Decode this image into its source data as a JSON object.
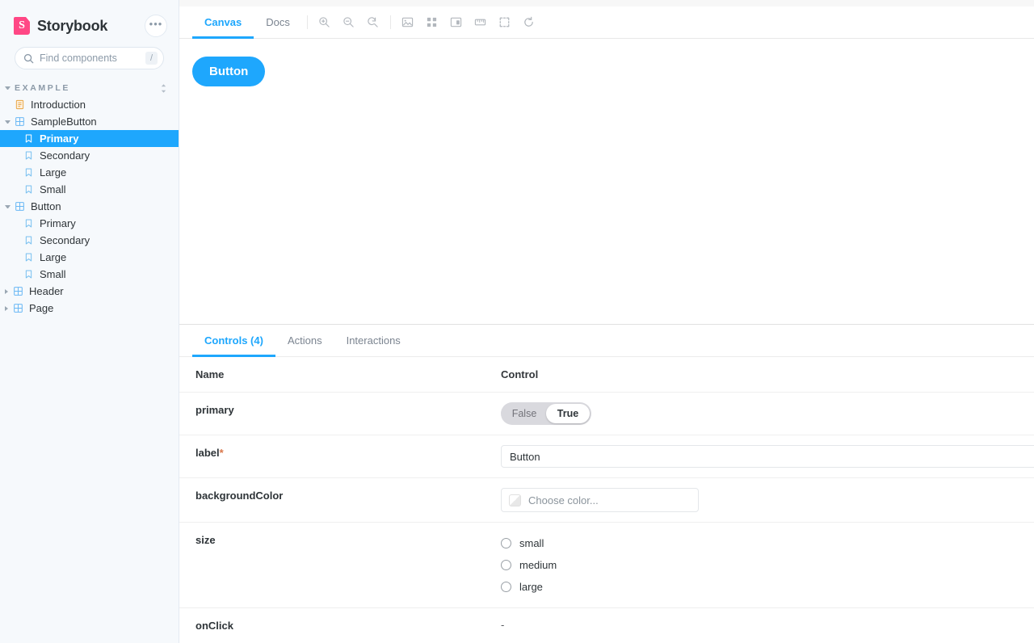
{
  "sidebar": {
    "brand": "Storybook",
    "logo_color": "#ff4785",
    "menu_label": "•••",
    "search": {
      "placeholder": "Find components",
      "value": "",
      "shortcut": "/",
      "icon": "search-icon"
    },
    "group": {
      "label": "EXAMPLE",
      "expanded": true
    },
    "items": [
      {
        "label": "Introduction",
        "icon": "document-icon",
        "level": 2,
        "selected": false,
        "expandable": false
      },
      {
        "label": "SampleButton",
        "icon": "component-icon",
        "level": 2,
        "selected": false,
        "expandable": true,
        "expanded": true
      },
      {
        "label": "Primary",
        "icon": "story-icon",
        "level": 3,
        "selected": true,
        "expandable": false
      },
      {
        "label": "Secondary",
        "icon": "story-icon",
        "level": 3,
        "selected": false,
        "expandable": false
      },
      {
        "label": "Large",
        "icon": "story-icon",
        "level": 3,
        "selected": false,
        "expandable": false
      },
      {
        "label": "Small",
        "icon": "story-icon",
        "level": 3,
        "selected": false,
        "expandable": false
      },
      {
        "label": "Button",
        "icon": "component-icon",
        "level": 2,
        "selected": false,
        "expandable": true,
        "expanded": true
      },
      {
        "label": "Primary",
        "icon": "story-icon",
        "level": 3,
        "selected": false,
        "expandable": false
      },
      {
        "label": "Secondary",
        "icon": "story-icon",
        "level": 3,
        "selected": false,
        "expandable": false
      },
      {
        "label": "Large",
        "icon": "story-icon",
        "level": 3,
        "selected": false,
        "expandable": false
      },
      {
        "label": "Small",
        "icon": "story-icon",
        "level": 3,
        "selected": false,
        "expandable": false
      },
      {
        "label": "Header",
        "icon": "component-icon",
        "level": 2,
        "selected": false,
        "expandable": true,
        "expanded": false
      },
      {
        "label": "Page",
        "icon": "component-icon",
        "level": 2,
        "selected": false,
        "expandable": true,
        "expanded": false
      }
    ],
    "selected_color": "#1ea7fd",
    "background": "#f6f9fc"
  },
  "toolbar": {
    "tabs": [
      {
        "label": "Canvas",
        "active": true
      },
      {
        "label": "Docs",
        "active": false
      }
    ],
    "icons": [
      "zoom-in-icon",
      "zoom-out-icon",
      "zoom-reset-icon",
      "backgrounds-icon",
      "grid-icon",
      "viewport-icon",
      "measure-icon",
      "outline-icon",
      "refresh-icon"
    ],
    "accent_color": "#1ea7fd"
  },
  "canvas": {
    "button_label": "Button",
    "button_color": "#1ea7fd"
  },
  "panel": {
    "tabs": [
      {
        "label": "Controls (4)",
        "active": true
      },
      {
        "label": "Actions",
        "active": false
      },
      {
        "label": "Interactions",
        "active": false
      }
    ],
    "columns": {
      "name": "Name",
      "control": "Control"
    },
    "rows": [
      {
        "name": "primary",
        "required": false,
        "type": "boolean-toggle",
        "options": [
          "False",
          "True"
        ],
        "value": "True"
      },
      {
        "name": "label",
        "required": true,
        "required_mark": "*",
        "type": "text",
        "value": "Button",
        "placeholder": ""
      },
      {
        "name": "backgroundColor",
        "required": false,
        "type": "color",
        "value": "",
        "placeholder": "Choose color..."
      },
      {
        "name": "size",
        "required": false,
        "type": "radio",
        "options": [
          "small",
          "medium",
          "large"
        ],
        "value": ""
      },
      {
        "name": "onClick",
        "required": false,
        "type": "none",
        "value": "-"
      }
    ]
  }
}
